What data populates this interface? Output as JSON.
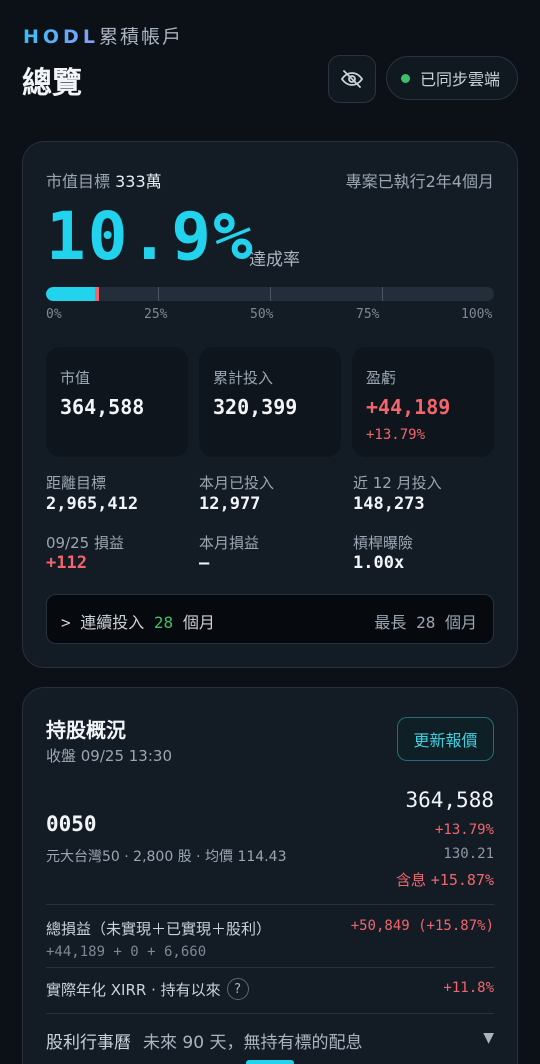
{
  "header": {
    "brand": "HODL",
    "brand_sub": "累積帳戶",
    "title": "總覽",
    "sync_status": "已同步雲端"
  },
  "overview": {
    "goal_label": "市值目標",
    "goal_value": "333萬",
    "exec_text": "專案已執行2年4個月",
    "achieve_pct": "10.9%",
    "achieve_label": "達成率",
    "progress_fraction": 0.109,
    "ticks": [
      "0%",
      "25%",
      "50%",
      "75%",
      "100%"
    ],
    "cards": [
      {
        "label": "市值",
        "value": "364,588",
        "sub": ""
      },
      {
        "label": "累計投入",
        "value": "320,399",
        "sub": ""
      },
      {
        "label": "盈虧",
        "value": "+44,189",
        "sub": "+13.79%"
      }
    ],
    "mini_stats": [
      {
        "label": "距離目標",
        "value": "2,965,412"
      },
      {
        "label": "本月已投入",
        "value": "12,977"
      },
      {
        "label": "近 12 月投入",
        "value": "148,273"
      },
      {
        "label": "09/25 損益",
        "value": "+112"
      },
      {
        "label": "本月損益",
        "value": "—"
      },
      {
        "label": "槓桿曝險",
        "value": "1.00x"
      }
    ],
    "streak": {
      "prefix": "> 連續投入",
      "count": "28",
      "unit": "個月",
      "longest_label": "最長",
      "longest_count": "28",
      "longest_unit": "個月"
    }
  },
  "holdings": {
    "title": "持股概況",
    "close_time": "收盤 09/25 13:30",
    "refresh_label": "更新報價",
    "ticker": "0050",
    "desc": "元大台灣50 · 2,800 股 · 均價 114.43",
    "market_value": "364,588",
    "pct": "+13.79%",
    "price": "130.21",
    "div_label": "含息",
    "div_pct": "+15.87%",
    "total_label": "總損益（未實現＋已實現＋股利）",
    "total_value": "+50,849 (+15.87%)",
    "total_breakdown": "+44,189 + 0 + 6,660",
    "xirr_label": "實際年化 XIRR · 持有以來",
    "xirr_q": "?",
    "xirr_value": "+11.8%",
    "div_cal_label": "股利行事曆",
    "div_cal_note": "未來 90 天，無持有標的配息",
    "caret": "▼"
  },
  "colors": {
    "accent": "#22d3ee",
    "loss_red": "#f2656b",
    "sync_green": "#3fbf6a",
    "background": "#0b1117"
  },
  "icons": {
    "visibility_toggle": "eye-slash-icon"
  }
}
